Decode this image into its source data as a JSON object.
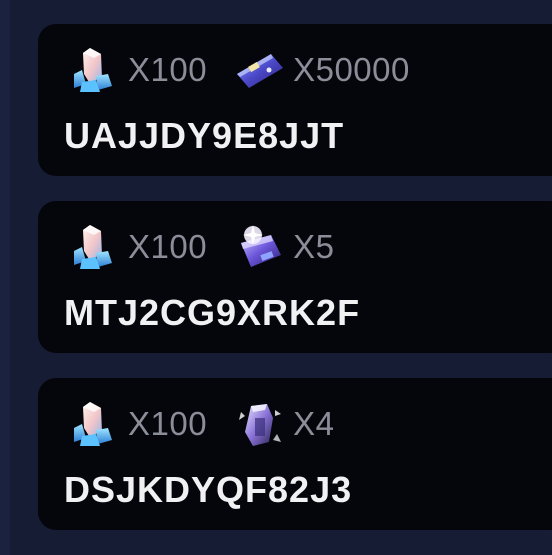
{
  "codes": [
    {
      "code": "UAJJDY9E8JJT",
      "rewards": [
        {
          "icon": "crystal-icon",
          "qty": "X100"
        },
        {
          "icon": "ticket-icon",
          "qty": "X50000"
        }
      ]
    },
    {
      "code": "MTJ2CG9XRK2F",
      "rewards": [
        {
          "icon": "crystal-icon",
          "qty": "X100"
        },
        {
          "icon": "sparkle-box-icon",
          "qty": "X5"
        }
      ]
    },
    {
      "code": "DSJKDYQF82J3",
      "rewards": [
        {
          "icon": "crystal-icon",
          "qty": "X100"
        },
        {
          "icon": "lantern-icon",
          "qty": "X4"
        }
      ]
    }
  ],
  "colors": {
    "background": "#151c33",
    "card": "#05060b",
    "code_text": "#f1f1f4",
    "qty_text": "#8b8e99"
  }
}
